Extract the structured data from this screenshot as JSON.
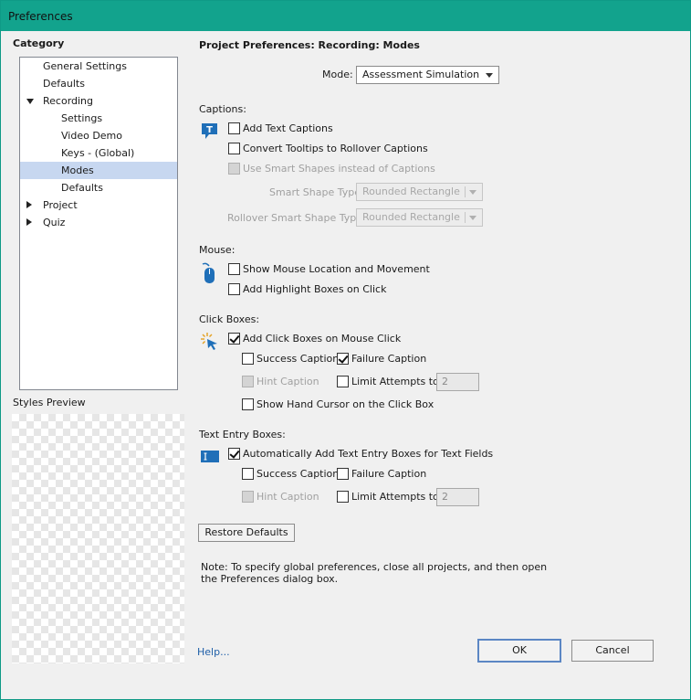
{
  "window": {
    "title": "Preferences"
  },
  "category": {
    "heading": "Category",
    "items": [
      {
        "label": "General Settings"
      },
      {
        "label": "Defaults"
      },
      {
        "label": "Recording"
      },
      {
        "label": "Settings"
      },
      {
        "label": "Video Demo"
      },
      {
        "label": "Keys - (Global)"
      },
      {
        "label": "Modes"
      },
      {
        "label": "Defaults"
      },
      {
        "label": "Project"
      },
      {
        "label": "Quiz"
      }
    ]
  },
  "styles_preview": {
    "label": "Styles Preview"
  },
  "panel": {
    "title": "Project Preferences: Recording: Modes",
    "mode_label": "Mode:",
    "mode_value": "Assessment Simulation"
  },
  "captions": {
    "heading": "Captions:",
    "add_text_captions": "Add Text Captions",
    "convert_tooltips": "Convert Tooltips to Rollover Captions",
    "use_smart_shapes": "Use Smart Shapes instead of Captions",
    "smart_shape_type_label": "Smart Shape Type",
    "smart_shape_type_value": "Rounded Rectangle",
    "rollover_smart_shape_type_label": "Rollover Smart Shape Type",
    "rollover_smart_shape_type_value": "Rounded Rectangle"
  },
  "mouse": {
    "heading": "Mouse:",
    "show_mouse_location": "Show Mouse Location and Movement",
    "add_highlight_boxes": "Add Highlight Boxes on Click"
  },
  "click_boxes": {
    "heading": "Click Boxes:",
    "add_click_boxes": "Add Click Boxes on Mouse Click",
    "success_caption": "Success Caption",
    "failure_caption": "Failure Caption",
    "hint_caption": "Hint Caption",
    "limit_attempts": "Limit Attempts to",
    "limit_value": "2",
    "show_hand_cursor": "Show Hand Cursor on the Click Box"
  },
  "text_entry_boxes": {
    "heading": "Text Entry Boxes:",
    "auto_add": "Automatically Add Text Entry Boxes for Text Fields",
    "success_caption": "Success Caption",
    "failure_caption": "Failure Caption",
    "hint_caption": "Hint Caption",
    "limit_attempts": "Limit Attempts to",
    "limit_value": "2"
  },
  "restore_defaults": "Restore Defaults",
  "note": {
    "line1": "Note: To specify global preferences, close all projects, and then open",
    "line2": "the Preferences dialog box."
  },
  "footer": {
    "help": "Help...",
    "ok": "OK",
    "cancel": "Cancel"
  },
  "colors": {
    "titlebar": "#12a38d",
    "selection": "#c7d7f0",
    "link": "#1f5fa8"
  }
}
